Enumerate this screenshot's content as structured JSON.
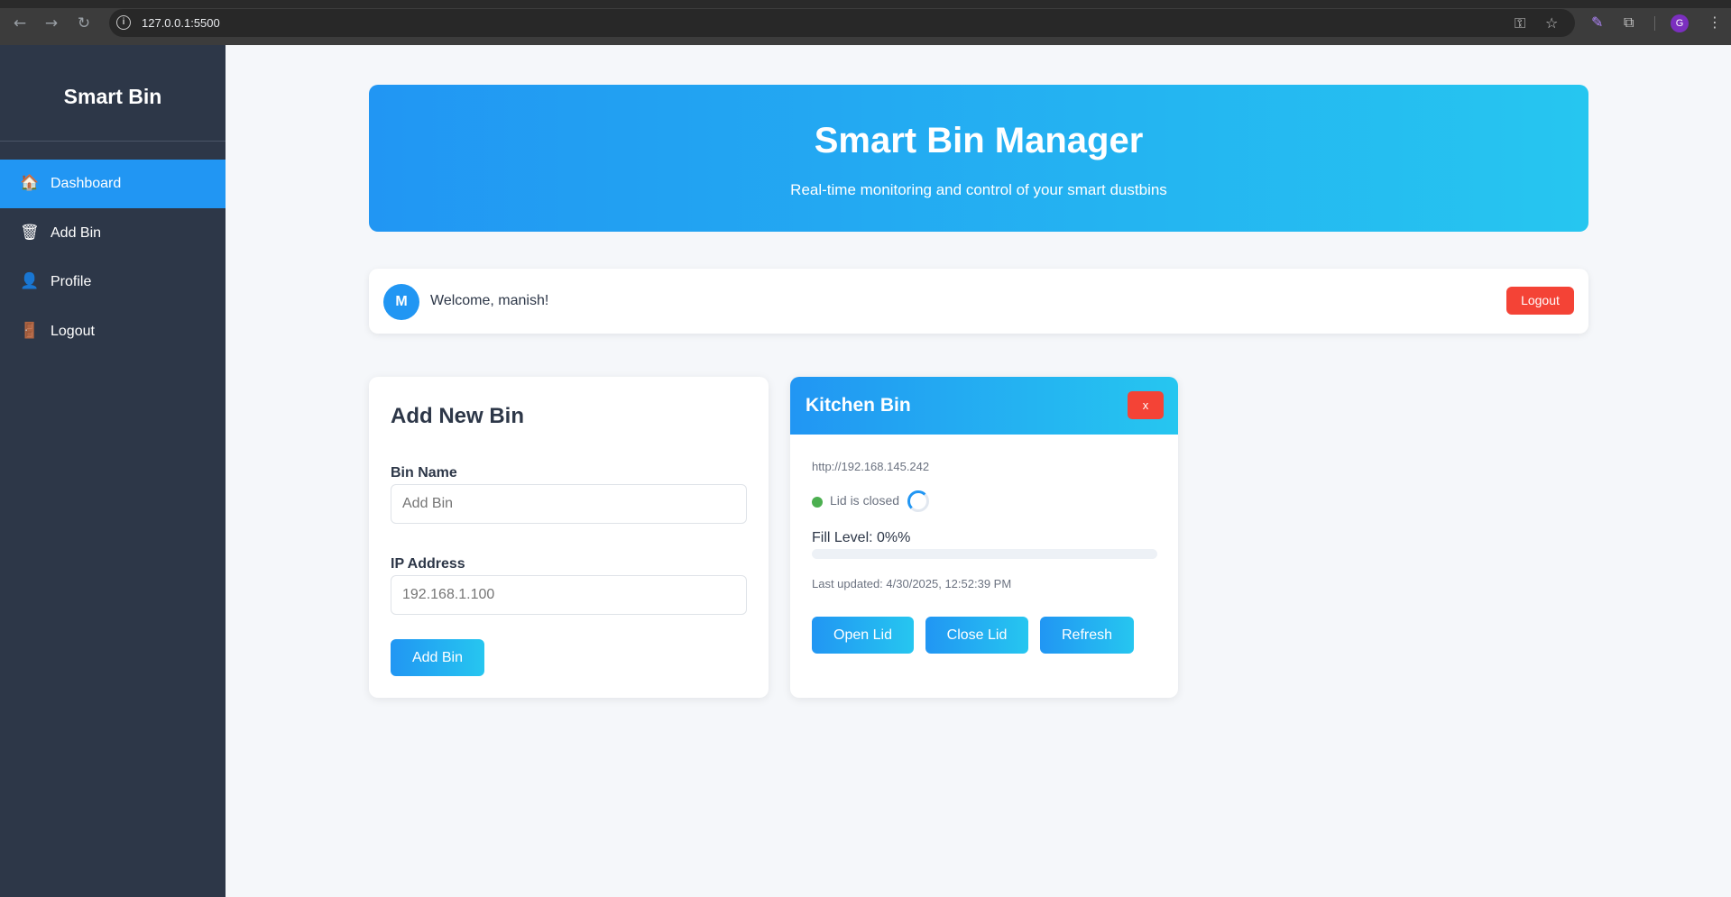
{
  "browser": {
    "url": "127.0.0.1:5500",
    "profile_initial": "G"
  },
  "sidebar": {
    "brand": "Smart Bin",
    "items": [
      {
        "label": "Dashboard",
        "icon": "house-icon",
        "glyph": "🏠"
      },
      {
        "label": "Add Bin",
        "icon": "wastebasket-icon",
        "glyph": "🗑"
      },
      {
        "label": "Profile",
        "icon": "user-icon",
        "glyph": "👤"
      },
      {
        "label": "Logout",
        "icon": "door-icon",
        "glyph": "🚪"
      }
    ]
  },
  "hero": {
    "title": "Smart Bin Manager",
    "subtitle": "Real-time monitoring and control of your smart dustbins"
  },
  "welcome": {
    "avatar_initial": "M",
    "text": "Welcome, manish!",
    "logout_label": "Logout"
  },
  "add_form": {
    "title": "Add New Bin",
    "name_label": "Bin Name",
    "name_placeholder": "Add Bin",
    "ip_label": "IP Address",
    "ip_placeholder": "192.168.1.100",
    "submit_label": "Add Bin"
  },
  "bin": {
    "name": "Kitchen Bin",
    "delete_label": "x",
    "ip": "http://192.168.145.242",
    "status": "Lid is closed",
    "fill_label": "Fill Level: 0%%",
    "fill_level": 0,
    "last_updated": "Last updated: 4/30/2025, 12:52:39 PM",
    "buttons": {
      "open": "Open Lid",
      "close": "Close Lid",
      "refresh": "Refresh"
    }
  },
  "colors": {
    "primary": "#2196f3",
    "accent": "#26c6f0",
    "danger": "#f44336",
    "sidebar": "#2d3748",
    "status_ok": "#4caf50"
  }
}
